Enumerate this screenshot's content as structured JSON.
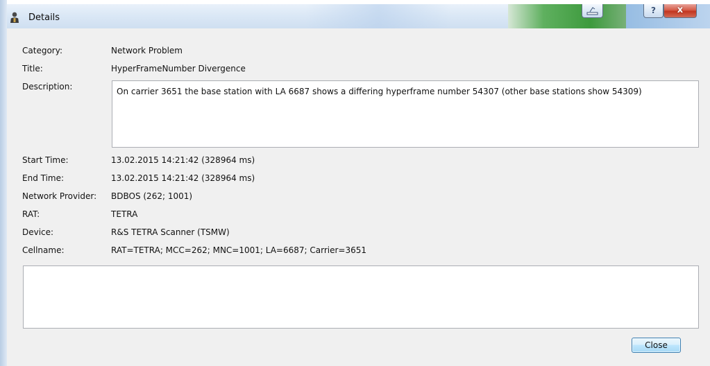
{
  "window": {
    "title": "Details",
    "help_glyph": "?",
    "close_glyph": "x",
    "icons": {
      "app": "person-icon",
      "minimize": "minimize-icon",
      "help": "help-icon",
      "close": "close-icon"
    },
    "colors": {
      "titlebar": "#dbe8f6",
      "close_red": "#c2351f",
      "body": "#f0f0f0"
    }
  },
  "details": {
    "category": {
      "label": "Category:",
      "value": "Network Problem"
    },
    "title": {
      "label": "Title:",
      "value": "HyperFrameNumber Divergence"
    },
    "description": {
      "label": "Description:",
      "value": "On carrier 3651 the base station with LA 6687 shows a differing hyperframe number 54307 (other base stations show 54309)"
    },
    "start_time": {
      "label": "Start Time:",
      "value": "13.02.2015 14:21:42 (328964 ms)"
    },
    "end_time": {
      "label": "End Time:",
      "value": "13.02.2015 14:21:42 (328964 ms)"
    },
    "network_provider": {
      "label": "Network Provider:",
      "value": "BDBOS (262; 1001)"
    },
    "rat": {
      "label": "RAT:",
      "value": "TETRA"
    },
    "device": {
      "label": "Device:",
      "value": "R&S TETRA Scanner (TSMW)"
    },
    "cellname": {
      "label": "Cellname:",
      "value": "RAT=TETRA; MCC=262; MNC=1001; LA=6687; Carrier=3651"
    }
  },
  "notes": {
    "value": ""
  },
  "footer": {
    "close_label": "Close"
  }
}
